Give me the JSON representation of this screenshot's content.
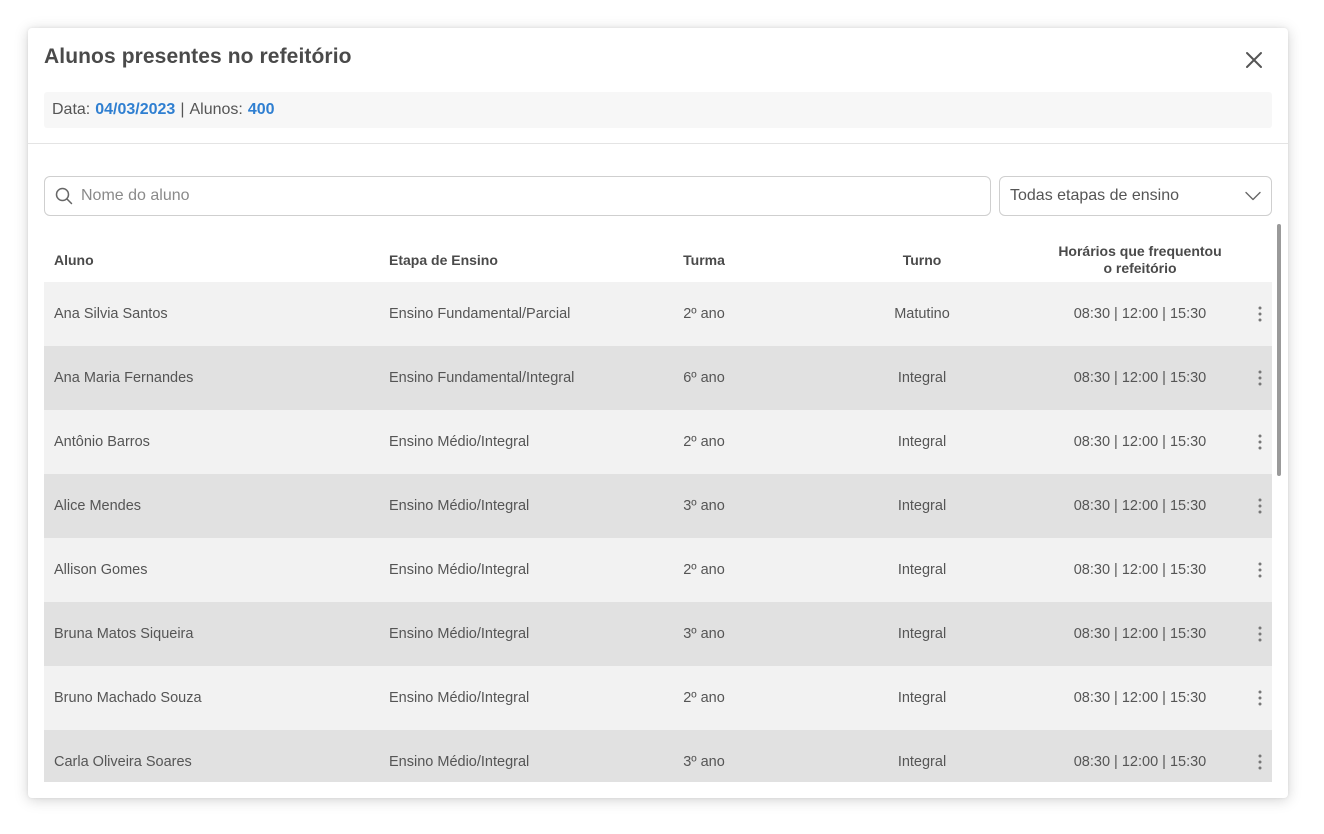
{
  "modal": {
    "title": "Alunos presentes no refeitório",
    "close_icon": "close-icon"
  },
  "info": {
    "date_label": "Data:",
    "date_value": "04/03/2023",
    "separator": "|",
    "students_label": "Alunos:",
    "students_value": "400"
  },
  "filters": {
    "search_placeholder": "Nome do aluno",
    "search_value": "",
    "stage_selected": "Todas etapas de ensino"
  },
  "table": {
    "headers": {
      "student": "Aluno",
      "stage": "Etapa de Ensino",
      "class": "Turma",
      "shift": "Turno",
      "times_line1": "Horários que frequentou",
      "times_line2": "o refeitório"
    },
    "rows": [
      {
        "student": "Ana Silvia Santos",
        "stage": "Ensino Fundamental/Parcial",
        "class": "2º ano",
        "shift": "Matutino",
        "times": "08:30 | 12:00 | 15:30"
      },
      {
        "student": "Ana Maria Fernandes",
        "stage": "Ensino Fundamental/Integral",
        "class": "6º ano",
        "shift": "Integral",
        "times": "08:30 | 12:00 | 15:30"
      },
      {
        "student": "Antônio Barros",
        "stage": "Ensino Médio/Integral",
        "class": "2º ano",
        "shift": "Integral",
        "times": "08:30 | 12:00 | 15:30"
      },
      {
        "student": "Alice Mendes",
        "stage": "Ensino Médio/Integral",
        "class": "3º ano",
        "shift": "Integral",
        "times": "08:30 | 12:00 | 15:30"
      },
      {
        "student": "Allison Gomes",
        "stage": "Ensino Médio/Integral",
        "class": "2º ano",
        "shift": "Integral",
        "times": "08:30 | 12:00 | 15:30"
      },
      {
        "student": "Bruna Matos Siqueira",
        "stage": "Ensino Médio/Integral",
        "class": "3º ano",
        "shift": "Integral",
        "times": "08:30 | 12:00 | 15:30"
      },
      {
        "student": "Bruno Machado Souza",
        "stage": "Ensino Médio/Integral",
        "class": "2º ano",
        "shift": "Integral",
        "times": "08:30 | 12:00 | 15:30"
      },
      {
        "student": "Carla Oliveira Soares",
        "stage": "Ensino Médio/Integral",
        "class": "3º ano",
        "shift": "Integral",
        "times": "08:30 | 12:00 | 15:30"
      }
    ]
  },
  "colors": {
    "accent": "#2f7fd1",
    "row_light": "#f2f2f2",
    "row_dark": "#e1e1e1"
  },
  "icons": {
    "search": "search-icon",
    "dropdown": "chevron-down-icon",
    "row_menu": "more-vertical-icon"
  }
}
